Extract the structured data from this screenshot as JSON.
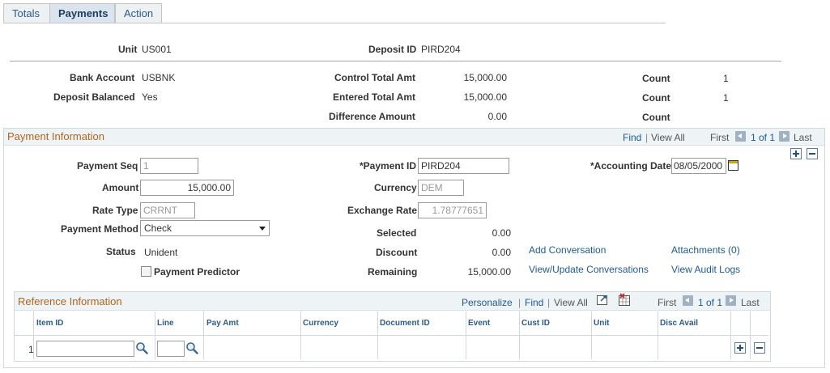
{
  "tabs": [
    {
      "label": "Totals",
      "active": false
    },
    {
      "label": "Payments",
      "active": true
    },
    {
      "label": "Action",
      "active": false
    }
  ],
  "header": {
    "unit_label": "Unit",
    "unit_value": "US001",
    "deposit_id_label": "Deposit ID",
    "deposit_id_value": "PIRD204"
  },
  "summary": {
    "bank_account_label": "Bank Account",
    "bank_account_value": "USBNK",
    "deposit_balanced_label": "Deposit Balanced",
    "deposit_balanced_value": "Yes",
    "control_total_label": "Control Total Amt",
    "control_total_value": "15,000.00",
    "entered_total_label": "Entered Total Amt",
    "entered_total_value": "15,000.00",
    "difference_label": "Difference Amount",
    "difference_value": "0.00",
    "count_label": "Count",
    "count1_value": "1",
    "count2_value": "1"
  },
  "payment_info": {
    "title": "Payment Information",
    "find": "Find",
    "sep": "|",
    "view_all": "View All",
    "first": "First",
    "pager": "1 of 1",
    "last": "Last",
    "payment_seq_label": "Payment Seq",
    "payment_seq_value": "1",
    "payment_id_label": "*Payment ID",
    "payment_id_value": "PIRD204",
    "accounting_date_label": "*Accounting Date",
    "accounting_date_value": "08/05/2000",
    "amount_label": "Amount",
    "amount_value": "15,000.00",
    "currency_label": "Currency",
    "currency_value": "DEM",
    "rate_type_label": "Rate Type",
    "rate_type_value": "CRRNT",
    "exchange_rate_label": "Exchange Rate",
    "exchange_rate_value": "1.78777651",
    "payment_method_label": "Payment Method",
    "payment_method_value": "Check",
    "selected_label": "Selected",
    "selected_value": "0.00",
    "status_label": "Status",
    "status_value": "Unident",
    "discount_label": "Discount",
    "discount_value": "0.00",
    "remaining_label": "Remaining",
    "remaining_value": "15,000.00",
    "payment_predictor_label": "Payment Predictor",
    "add_conversation": "Add Conversation",
    "attachments": "Attachments (0)",
    "view_update_conversations": "View/Update Conversations",
    "view_audit_logs": "View Audit Logs"
  },
  "reference_info": {
    "title": "Reference Information",
    "personalize": "Personalize",
    "find": "Find",
    "sep": "|",
    "view_all": "View All",
    "first": "First",
    "pager": "1 of 1",
    "last": "Last",
    "columns": [
      "Item ID",
      "Line",
      "Pay Amt",
      "Currency",
      "Document ID",
      "Event",
      "Cust ID",
      "Unit",
      "Disc Avail"
    ],
    "rows": [
      {
        "num": "1",
        "item_id": "",
        "line": ""
      }
    ]
  },
  "colors": {
    "accent_title": "#b2641c",
    "link": "#1f5a94"
  }
}
